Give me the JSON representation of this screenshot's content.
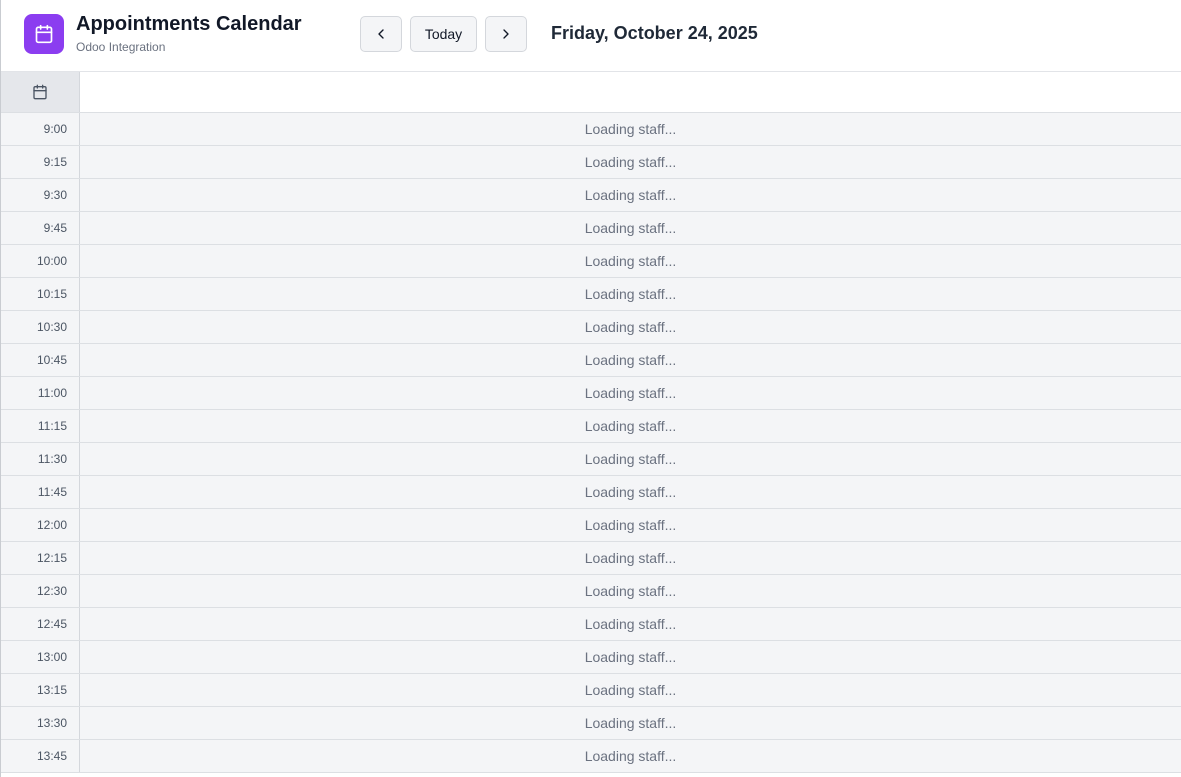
{
  "header": {
    "title": "Appointments Calendar",
    "subtitle": "Odoo Integration",
    "logo_icon": "calendar-icon",
    "logo_color": "#8b3df0",
    "prev_icon": "chevron-left-icon",
    "today_label": "Today",
    "next_icon": "chevron-right-icon",
    "current_date": "Friday, October 24, 2025"
  },
  "grid": {
    "corner_icon": "calendar-icon",
    "rows": [
      {
        "time": "9:00",
        "status": "Loading staff..."
      },
      {
        "time": "9:15",
        "status": "Loading staff..."
      },
      {
        "time": "9:30",
        "status": "Loading staff..."
      },
      {
        "time": "9:45",
        "status": "Loading staff..."
      },
      {
        "time": "10:00",
        "status": "Loading staff..."
      },
      {
        "time": "10:15",
        "status": "Loading staff..."
      },
      {
        "time": "10:30",
        "status": "Loading staff..."
      },
      {
        "time": "10:45",
        "status": "Loading staff..."
      },
      {
        "time": "11:00",
        "status": "Loading staff..."
      },
      {
        "time": "11:15",
        "status": "Loading staff..."
      },
      {
        "time": "11:30",
        "status": "Loading staff..."
      },
      {
        "time": "11:45",
        "status": "Loading staff..."
      },
      {
        "time": "12:00",
        "status": "Loading staff..."
      },
      {
        "time": "12:15",
        "status": "Loading staff..."
      },
      {
        "time": "12:30",
        "status": "Loading staff..."
      },
      {
        "time": "12:45",
        "status": "Loading staff..."
      },
      {
        "time": "13:00",
        "status": "Loading staff..."
      },
      {
        "time": "13:15",
        "status": "Loading staff..."
      },
      {
        "time": "13:30",
        "status": "Loading staff..."
      },
      {
        "time": "13:45",
        "status": "Loading staff..."
      }
    ]
  }
}
